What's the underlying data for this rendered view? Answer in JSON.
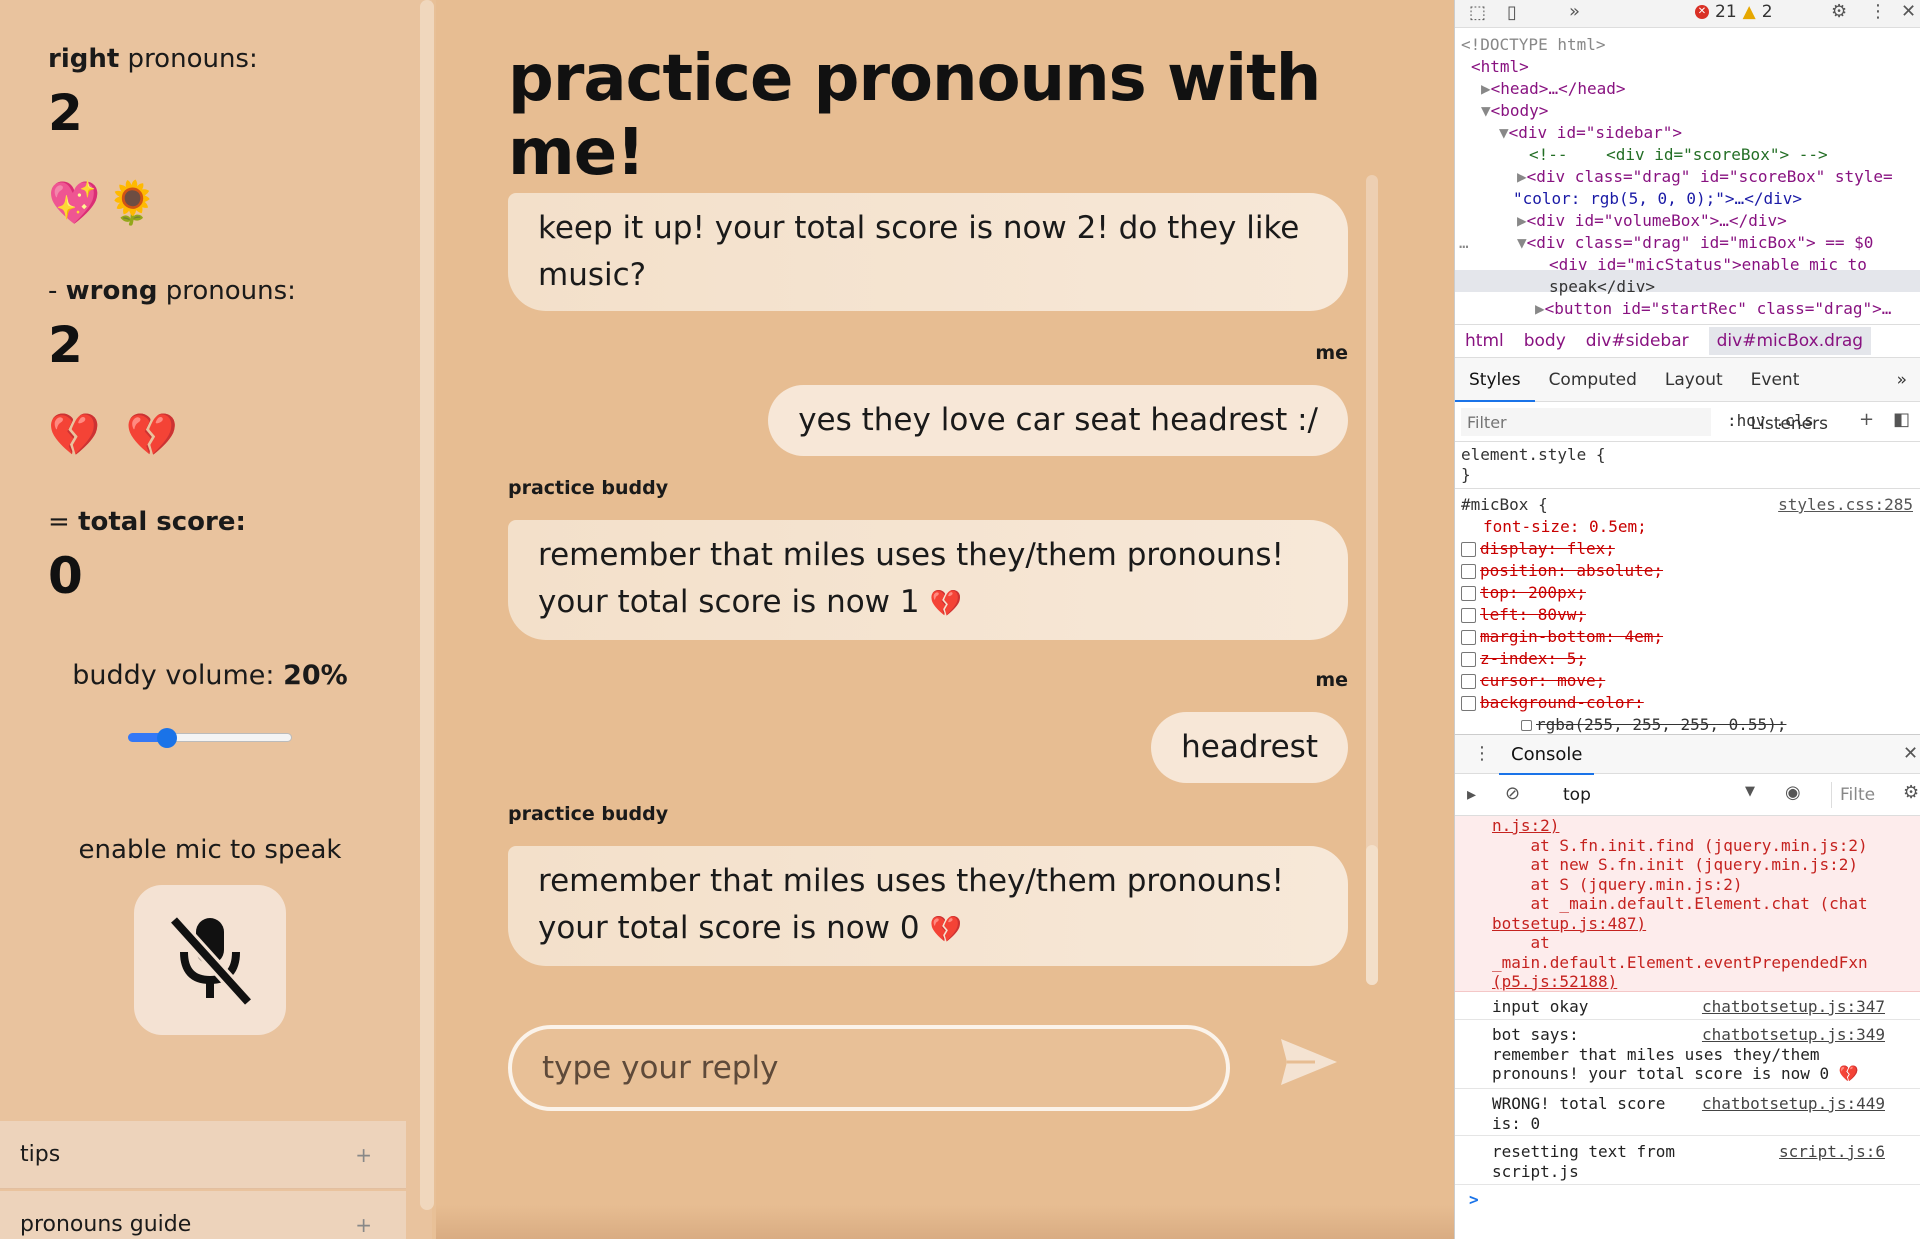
{
  "sidebar": {
    "right_label_bold": "right",
    "right_label_rest": " pronouns:",
    "right_count": "2",
    "right_emojis": "💖🌻",
    "wrong_label_prefix": "- ",
    "wrong_label_bold": "wrong",
    "wrong_label_rest": " pronouns:",
    "wrong_count": "2",
    "wrong_emojis": "💔 💔",
    "total_label_prefix": "= ",
    "total_label_bold": "total score:",
    "total_count": "0",
    "volume_label": "buddy volume: ",
    "volume_value": "20%",
    "volume_level": 0.2,
    "mic_status": "enable mic to speak",
    "accordion": [
      {
        "label": "tips",
        "icon": "+"
      },
      {
        "label": "pronouns guide",
        "icon": "+"
      }
    ]
  },
  "main": {
    "title": "practice pronouns with me!",
    "messages": [
      {
        "speaker": "",
        "text_lines": [
          "keep it up! your total score is now 2! do they like",
          "music?"
        ]
      },
      {
        "speaker": "me",
        "text_lines": [
          "yes they love car seat headrest :/"
        ]
      },
      {
        "speaker": "practice buddy",
        "text_lines": [
          "remember that miles uses they/them pronouns!",
          "your total score is now 1 "
        ],
        "emoji": "💔"
      },
      {
        "speaker": "me",
        "text_lines": [
          "headrest"
        ]
      },
      {
        "speaker": "practice buddy",
        "text_lines": [
          "remember that miles uses they/them pronouns!",
          "your total score is now 0 "
        ],
        "emoji": "💔"
      }
    ],
    "reply_placeholder": "type your reply"
  },
  "devtools": {
    "errors": "21",
    "warnings": "2",
    "dom": {
      "doctype": "<!DOCTYPE html>",
      "html_open": "<html>",
      "head": "<head>…</head>",
      "body_open": "<body>",
      "sidebar_div": "<div id=\"sidebar\">",
      "comment": "<!--    <div id=\"scoreBox\"> -->",
      "scorebox_a": "<div class=\"drag\" id=\"scoreBox\" style=",
      "scorebox_b": "\"color: rgb(5, 0, 0);\">…</div>",
      "volumebox": "<div id=\"volumeBox\">…</div>",
      "micbox": "<div class=\"drag\" id=\"micBox\"> == $0",
      "micstatus_a": "<div id=\"micStatus\">enable mic to",
      "micstatus_b": "speak</div>",
      "startrec": "<button id=\"startRec\" class=\"drag\">…"
    },
    "breadcrumbs": [
      "html",
      "body",
      "div#sidebar",
      "div#micBox.drag"
    ],
    "style_tabs": [
      "Styles",
      "Computed",
      "Layout",
      "Event Listeners"
    ],
    "filter_placeholder": "Filter",
    "filter_tools": ":hov  .cls",
    "styles": {
      "element_style": "element.style {",
      "close_brace": "}",
      "selector": "#micBox {",
      "source": "styles.css:285",
      "active_prop": "font-size: 0.5em;",
      "struck_props": [
        "display: flex;",
        "position: absolute;",
        "top: 200px;",
        "left: 80vw;",
        "margin-bottom: 4em;",
        "z-index: 5;",
        "cursor: move;",
        "background-color:"
      ],
      "bg_value": "rgba(255, 255, 255, 0.55);"
    },
    "console_tab": "Console",
    "context": "top",
    "filter_short": "Filte",
    "error_lines": [
      "n.js:2)",
      "    at S.fn.init.find (jquery.min.js:2)",
      "    at new S.fn.init (jquery.min.js:2)",
      "    at S (jquery.min.js:2)",
      "    at _main.default.Element.chat (chat",
      "botsetup.js:487)",
      "    at",
      "_main.default.Element.eventPrependedFxn",
      "(p5.js:52188)"
    ],
    "logs": [
      {
        "lines": [
          "input okay"
        ],
        "src": "chatbotsetup.js:347"
      },
      {
        "lines": [
          "bot says:",
          "remember that miles uses they/them",
          "pronouns! your total score is now 0 💔"
        ],
        "src": "chatbotsetup.js:349"
      },
      {
        "lines": [
          "WRONG! total score",
          "is: 0"
        ],
        "src": "chatbotsetup.js:449"
      },
      {
        "lines": [
          "resetting text from",
          "script.js"
        ],
        "src": "script.js:6"
      }
    ],
    "prompt": ">"
  }
}
